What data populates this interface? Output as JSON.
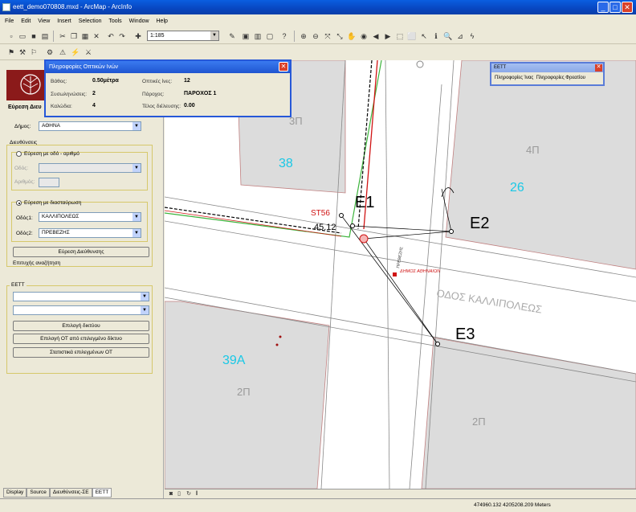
{
  "window": {
    "title": "eett_demo070808.mxd - ArcMap - ArcInfo"
  },
  "menu": [
    "File",
    "Edit",
    "View",
    "Insert",
    "Selection",
    "Tools",
    "Window",
    "Help"
  ],
  "toolbar": {
    "scale": "1:185"
  },
  "popup": {
    "title": "Πληροφορίες Οπτικών Ινών",
    "fields": [
      {
        "label": "Βάθος:",
        "value": "0.50μέτρα"
      },
      {
        "label": "Συσωληνώσεις:",
        "value": "2"
      },
      {
        "label": "Καλώδια:",
        "value": "4"
      },
      {
        "label": "Οπτικές ίνες:",
        "value": "12"
      },
      {
        "label": "Πάροχος:",
        "value": "ΠΑΡΟΧΟΣ 1"
      },
      {
        "label": "Τέλος διέλευσης:",
        "value": "0.00"
      }
    ]
  },
  "eett_box": {
    "title": "ΕΕΤΤ",
    "btn1": "Πληροφορίες Ίνας",
    "btn2": "Πληροφορίες Φρεατίου"
  },
  "left": {
    "heading": "Εύρεση Διευ",
    "dimos_label": "Δήμος:",
    "dimos_value": "ΑΘΗΝΑ",
    "addresses_label": "Διευθύνσεις",
    "radio1": "Εύρεση με οδό - αριθμό",
    "odos_label": "Οδός:",
    "arithmos_label": "Αριθμός:",
    "radio2": "Εύρεση με διασταύρωση",
    "odos1_label": "Οδός1:",
    "odos1_value": "ΚΑΛΛΙΠΟΛΕΩΣ",
    "odos2_label": "Οδός2:",
    "odos2_value": "ΠΡΕΒΕΖΗΣ",
    "find_button": "Εύρεση Διεύθυνσης",
    "success": "Επιτυχής αναζήτηση",
    "eett_label": "ΕΕΤΤ",
    "btn_network": "Επιλογή δικτύου",
    "btn_ot": "Επιλογή ΟΤ από επιλεγμένο δίκτυο",
    "btn_stats": "Στατιστικά επιλεγμένων ΟΤ"
  },
  "tabs": [
    "Display",
    "Source",
    "Διευθύνσεις-ΣΕ",
    "ΕΕΤΤ"
  ],
  "map": {
    "blocks": [
      "38",
      "3Π",
      "26",
      "4Π",
      "39Α",
      "2Π",
      "2Π"
    ],
    "nodes": [
      "Ε1",
      "Ε2",
      "Ε3"
    ],
    "street": "ΟΔΟΣ ΚΑΛΛΙΠΟΛΕΩΣ",
    "side_street": "ΠΡΕΒΕΖΗΣ",
    "st_label": "ST56",
    "distance": "45.12",
    "municipality_label": "ΔΗΜΟΣ ΑΘΗΝΑΙΩΝ"
  },
  "status": {
    "coords": "474960.132  4205208.209 Meters"
  },
  "colors": {
    "block_fill": "#dcdcdc",
    "fiber_green": "#3cb43c",
    "cyan_label": "#19c8e6",
    "red": "#d01414"
  }
}
